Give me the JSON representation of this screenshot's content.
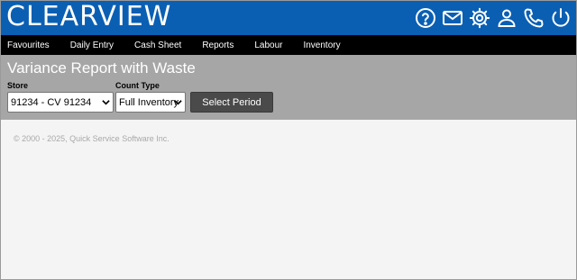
{
  "brand": {
    "logo_text": "CLEARVIEW",
    "color": "#0a5fb3"
  },
  "header_icons": [
    "help-icon",
    "mail-icon",
    "settings-icon",
    "user-icon",
    "phone-icon",
    "power-icon"
  ],
  "nav": {
    "items": [
      "Favourites",
      "Daily Entry",
      "Cash Sheet",
      "Reports",
      "Labour",
      "Inventory"
    ]
  },
  "page": {
    "title": "Variance Report with Waste"
  },
  "filters": {
    "store_label": "Store",
    "store_value": "91234 - CV 91234",
    "count_type_label": "Count Type",
    "count_type_value": "Full Inventory",
    "select_period_label": "Select Period"
  },
  "footer": {
    "copyright": "© 2000 - 2025, Quick Service Software Inc."
  }
}
